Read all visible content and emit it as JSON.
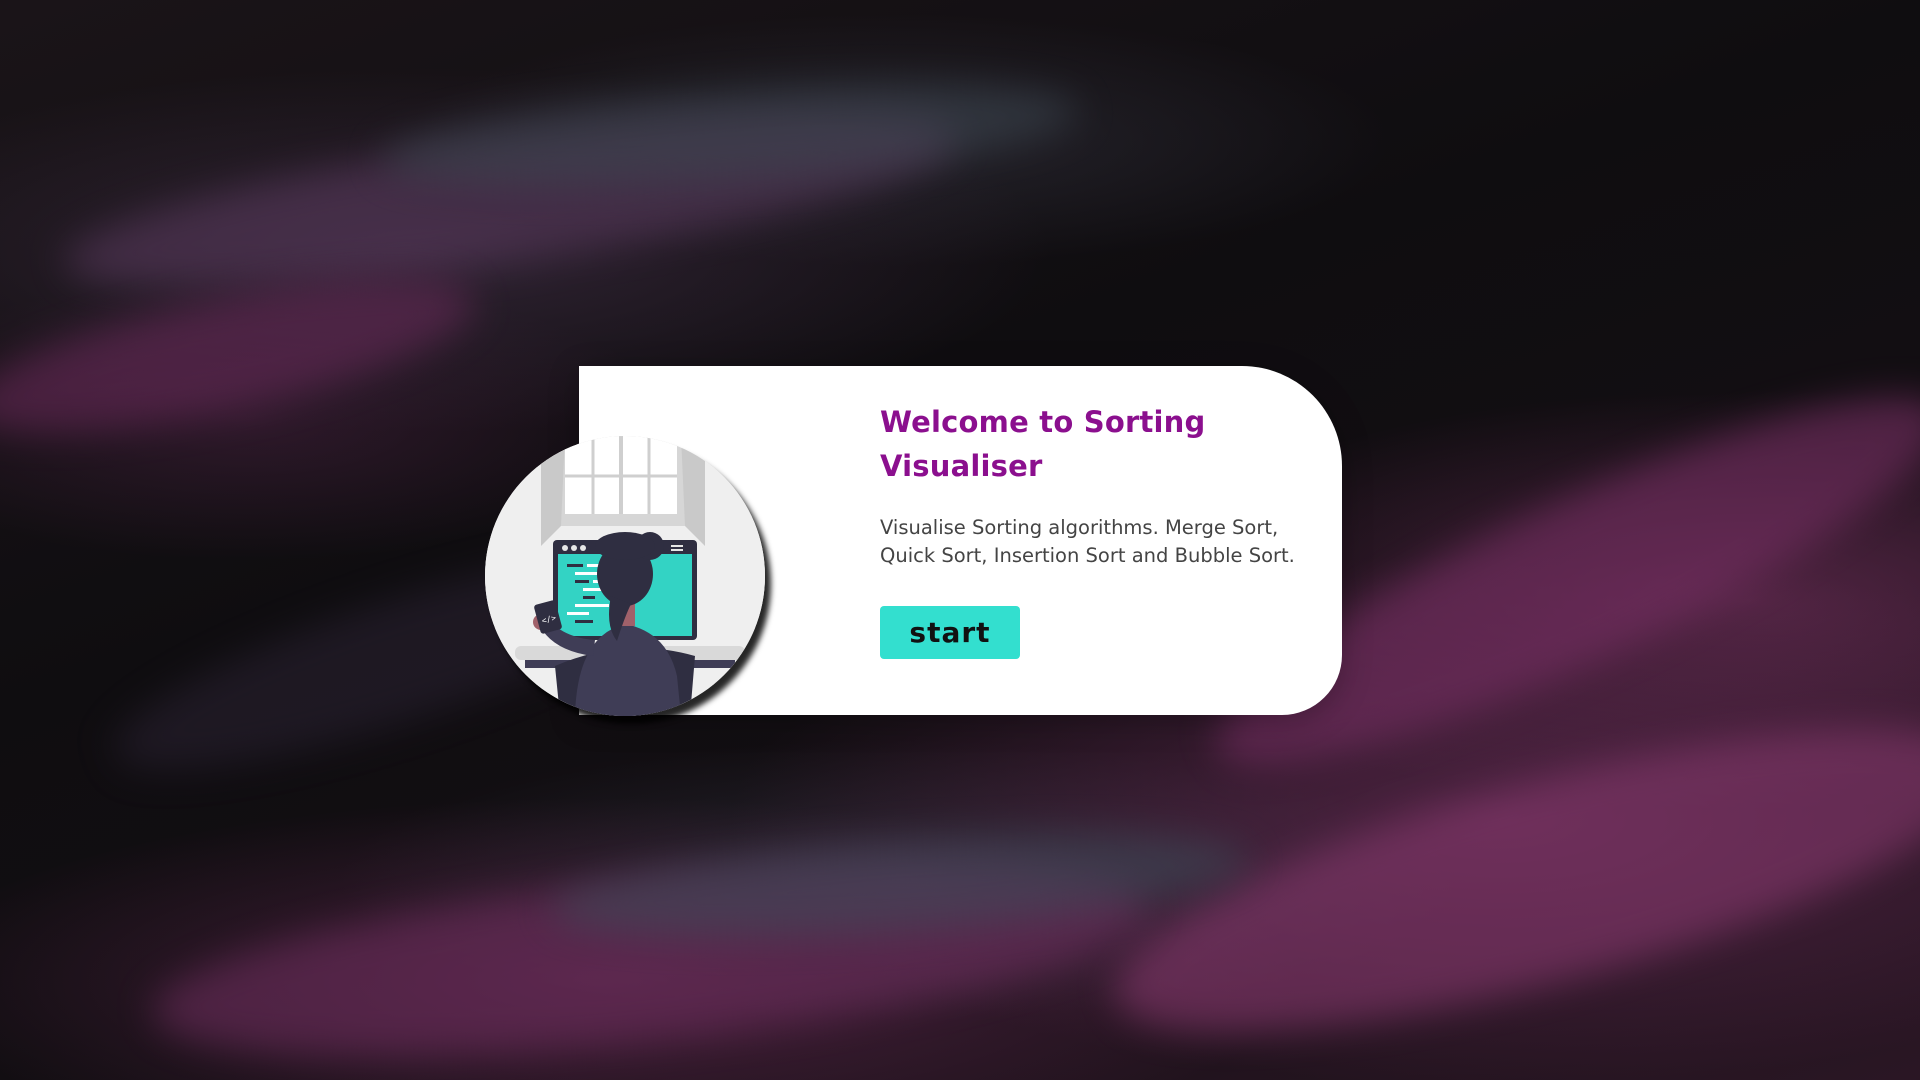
{
  "welcome_card": {
    "title": "Welcome to Sorting Visualiser",
    "description": "Visualise Sorting algorithms. Merge Sort, Quick Sort, Insertion Sort and Bubble Sort.",
    "start_label": "start"
  },
  "colors": {
    "title": "#8b0f8e",
    "button": "#33dfcf",
    "card": "#ffffff"
  },
  "icons": {
    "illustration": "developer-at-computer-illustration"
  }
}
